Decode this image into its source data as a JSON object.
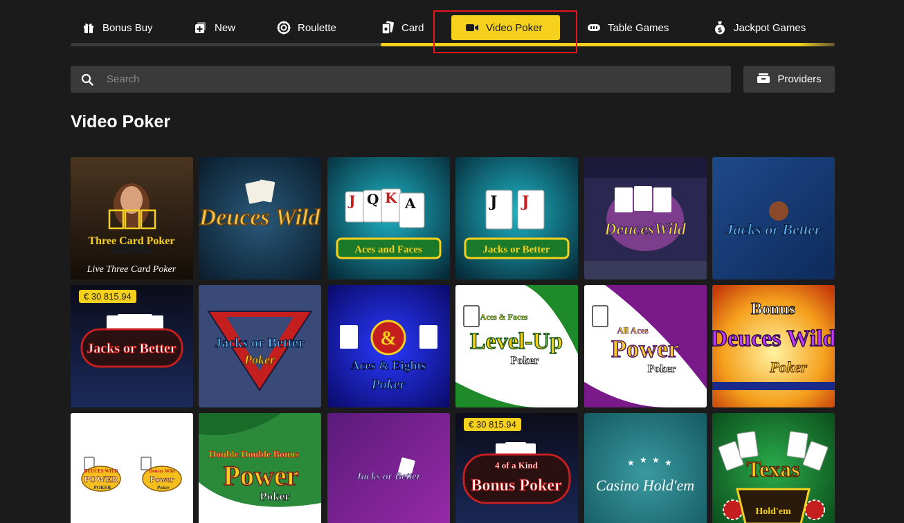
{
  "tabs": [
    {
      "label": "Bonus Buy",
      "icon": "gift-icon"
    },
    {
      "label": "New",
      "icon": "plus-square-icon"
    },
    {
      "label": "Roulette",
      "icon": "roulette-wheel-icon"
    },
    {
      "label": "Card",
      "icon": "cards-icon"
    },
    {
      "label": "Video Poker",
      "icon": "video-camera-icon"
    },
    {
      "label": "Table Games",
      "icon": "table-games-icon"
    },
    {
      "label": "Jackpot Games",
      "icon": "money-bag-icon"
    }
  ],
  "active_tab": "Video Poker",
  "search": {
    "placeholder": "Search"
  },
  "providers_label": "Providers",
  "section_title": "Video Poker",
  "games": [
    {
      "title": "Three Card Poker",
      "subtitle": "Live Three Card Poker"
    },
    {
      "title": "Deuces Wild"
    },
    {
      "title": "Aces and Faces"
    },
    {
      "title": "Jacks or Better"
    },
    {
      "title": "DeucesWild"
    },
    {
      "title": "Jacks or Better"
    },
    {
      "title": "Jacks or Better",
      "jackpot": "€ 30 815.94"
    },
    {
      "title": "Jacks or Better",
      "subtitle": "Poker"
    },
    {
      "title": "Aces & Eights",
      "subtitle": "Poker"
    },
    {
      "title": "Level-Up",
      "subtitle": "Poker",
      "top": "Aces & Faces"
    },
    {
      "title": "Power",
      "subtitle": "Poker",
      "top": "All Aces"
    },
    {
      "title": "Deuces Wild",
      "subtitle": "Poker",
      "top": "Bonus"
    },
    {
      "title": "Power",
      "subtitle": "Poker",
      "top": "Deuces Wild"
    },
    {
      "title": "Power",
      "subtitle": "Poker",
      "top": "Double Double Bonus"
    },
    {
      "title": "Jacks or Better"
    },
    {
      "title": "Bonus Poker",
      "top": "4 of a Kind",
      "jackpot": "€ 30 815.94"
    },
    {
      "title": "Casino Hold'em"
    },
    {
      "title": "Texas",
      "subtitle": "Hold'em"
    }
  ]
}
